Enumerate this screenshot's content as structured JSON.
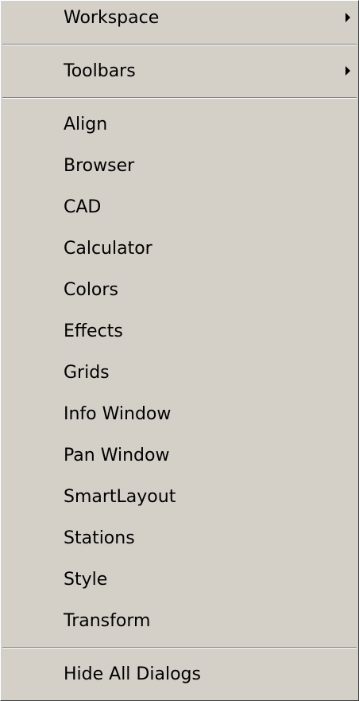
{
  "menu": {
    "submenus": [
      {
        "label": "Workspace",
        "icon": "submenu-arrow-icon"
      },
      {
        "label": "Toolbars",
        "icon": "submenu-arrow-icon"
      }
    ],
    "items": [
      "Align",
      "Browser",
      "CAD",
      "Calculator",
      "Colors",
      "Effects",
      "Grids",
      "Info Window",
      "Pan Window",
      "SmartLayout",
      "Stations",
      "Style",
      "Transform"
    ],
    "footer_item": "Hide All Dialogs"
  },
  "colors": {
    "background": "#d4d0c8",
    "text": "#000000",
    "separator_dark": "#808080",
    "separator_light": "#ffffff"
  }
}
